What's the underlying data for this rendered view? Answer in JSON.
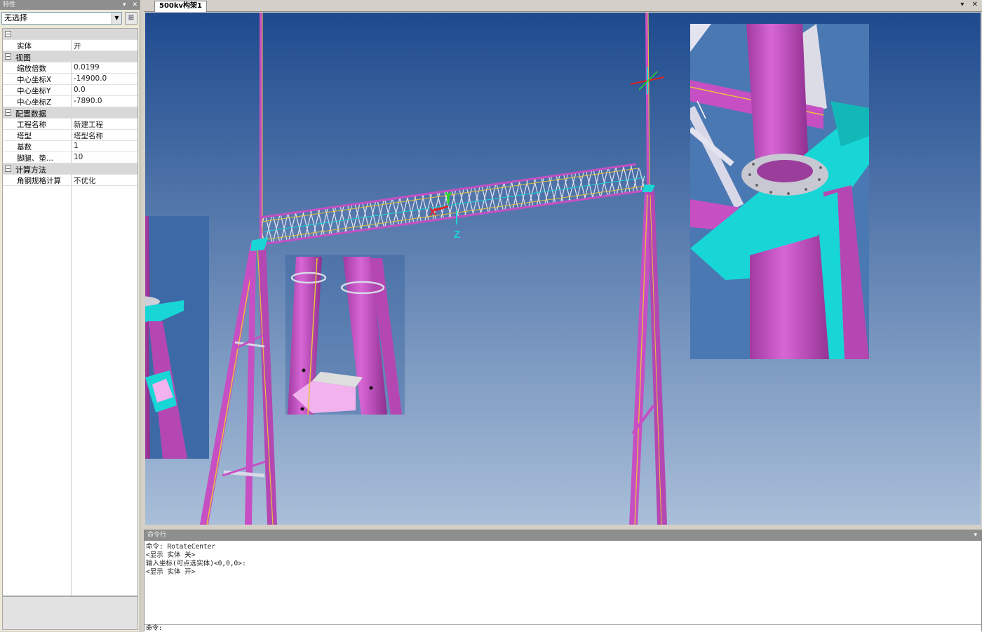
{
  "left_panel": {
    "title": "特性",
    "selector_value": "无选择",
    "groups": [
      {
        "label": "",
        "rows": [
          {
            "name": "实体",
            "value": "开"
          }
        ]
      },
      {
        "label": "视图",
        "rows": [
          {
            "name": "缩放倍数",
            "value": "0.0199"
          },
          {
            "name": "中心坐标X",
            "value": "-14900.0"
          },
          {
            "name": "中心坐标Y",
            "value": "0.0"
          },
          {
            "name": "中心坐标Z",
            "value": "-7890.0"
          }
        ]
      },
      {
        "label": "配置数据",
        "rows": [
          {
            "name": "工程名称",
            "value": "新建工程"
          },
          {
            "name": "塔型",
            "value": "塔型名称"
          },
          {
            "name": "基数",
            "value": "1"
          },
          {
            "name": "脚腿、垫...",
            "value": "10"
          }
        ]
      },
      {
        "label": "计算方法",
        "rows": [
          {
            "name": "角钢规格计算",
            "value": "不优化"
          }
        ]
      }
    ]
  },
  "document": {
    "tab_label": "500kv构架1"
  },
  "viewport": {
    "axis_labels": {
      "x": "X",
      "y": "Y",
      "z": "Z"
    },
    "colors": {
      "sky_top": "#1e4a8e",
      "sky_bottom": "#a9bfd9",
      "member": "#c64fc4",
      "plate": "#18d6d6",
      "truss": "#d8d8e8"
    }
  },
  "command": {
    "title": "命令行",
    "history": [
      "命令: RotateCenter",
      "<显示 实体 关>",
      "输入坐标(可点选实体)<0,0,0>:",
      "<显示 实体 开>"
    ],
    "prompt": "命令:"
  }
}
